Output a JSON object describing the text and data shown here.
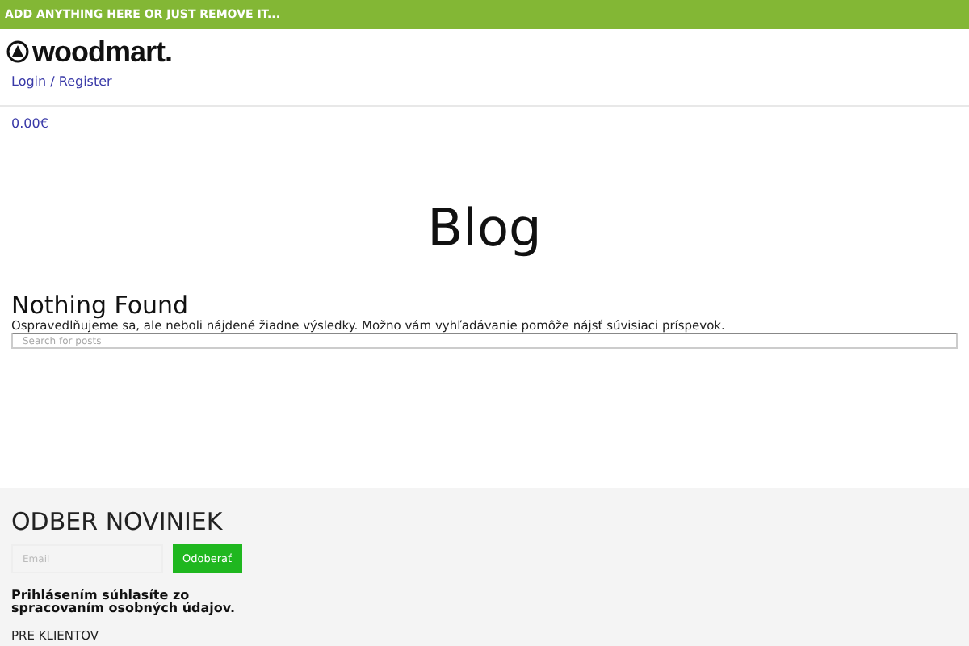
{
  "top_bar": {
    "text": "ADD ANYTHING HERE OR JUST REMOVE IT..."
  },
  "header": {
    "logo": "woodmart.",
    "account_link": "Login / Register",
    "cart_total": "0.00€"
  },
  "page_title": "Blog",
  "content": {
    "heading": "Nothing Found",
    "message": "Ospravedlňujeme sa, ale neboli nájdené žiadne výsledky. Možno vám vyhľadávanie pomôže nájsť súvisiaci príspevok.",
    "search": {
      "placeholder": "Search for posts"
    }
  },
  "footer": {
    "newsletter_title": "ODBER NOVINIEK",
    "email": {
      "placeholder": "Email"
    },
    "subscribe_button": "Odoberať",
    "consent": "Prihlásením súhlasíte zo spracovaním osobných údajov.",
    "section_title": "PRE KLIENTOV"
  }
}
